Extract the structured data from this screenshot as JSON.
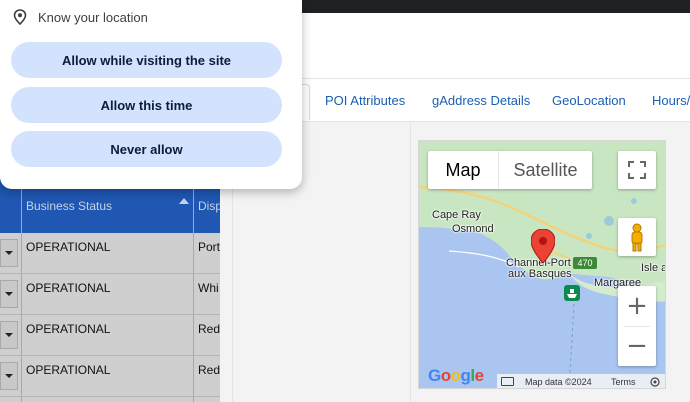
{
  "permission_popup": {
    "title": "Know your location",
    "buttons": {
      "allow_visiting": "Allow while visiting the site",
      "allow_once": "Allow this time",
      "never": "Never allow"
    }
  },
  "tabs": [
    {
      "label": "POI Attributes"
    },
    {
      "label": "gAddress Details"
    },
    {
      "label": "GeoLocation"
    },
    {
      "label": "Hours/S"
    }
  ],
  "table": {
    "columns": [
      "Business Status",
      "Disp"
    ],
    "rows": [
      {
        "status": "OPERATIONAL",
        "disp": "Port"
      },
      {
        "status": "OPERATIONAL",
        "disp": "Whi"
      },
      {
        "status": "OPERATIONAL",
        "disp": "Red"
      },
      {
        "status": "OPERATIONAL",
        "disp": "Red"
      }
    ]
  },
  "map": {
    "type_buttons": {
      "map": "Map",
      "satellite": "Satellite"
    },
    "zoom": {
      "in": "+",
      "out": "−"
    },
    "places": {
      "cape_ray": "Cape Ray",
      "osmond": "Osmond",
      "channel_line1": "Channel-Port",
      "channel_line2": "aux Basques",
      "isle": "Isle a",
      "margaree": "Margaree"
    },
    "route_number": "470",
    "attribution": {
      "data": "Map data ©2024",
      "terms": "Terms"
    },
    "logo": "Google",
    "colors": {
      "water": "#a9c5f0",
      "land": "#c9e6c2",
      "marker": "#ea4335"
    }
  }
}
